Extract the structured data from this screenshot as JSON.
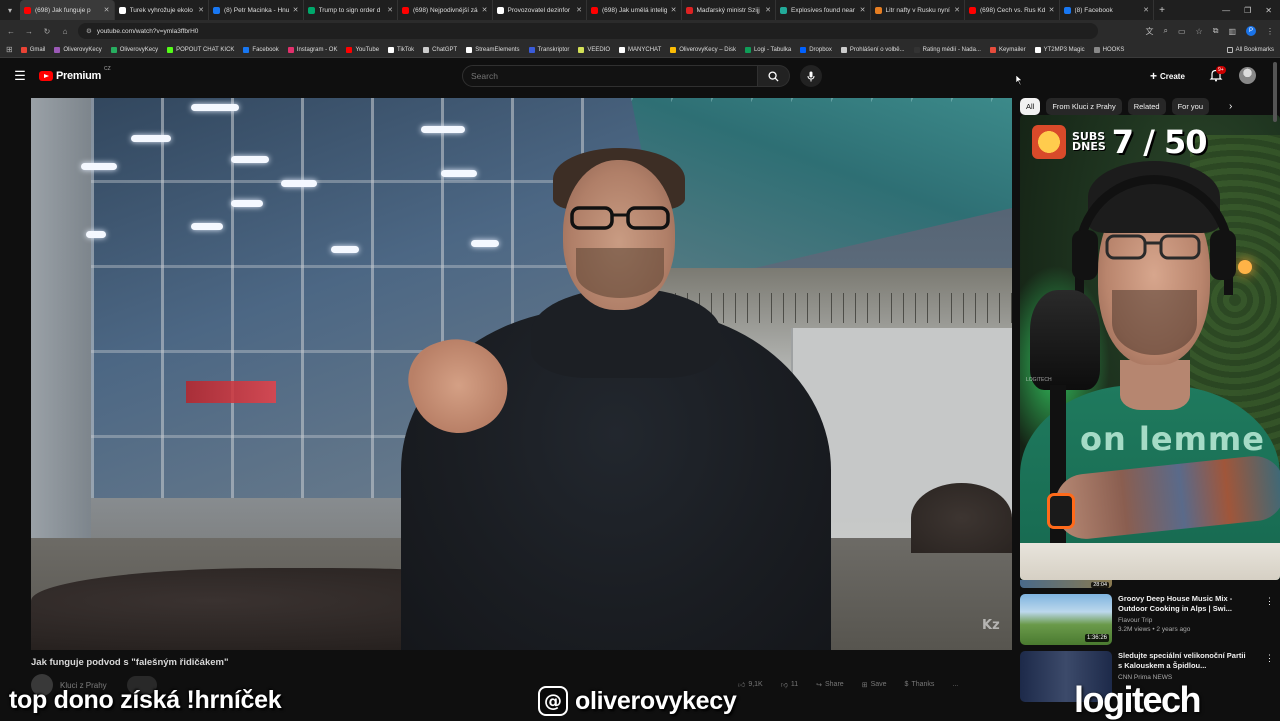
{
  "browser": {
    "tabs": [
      {
        "label": "(698) Jak funguje p",
        "color": "#ff0000",
        "active": true
      },
      {
        "label": "Turek vyhrožuje ekolo",
        "color": "#ffffff"
      },
      {
        "label": "(8) Petr Macinka - Hnu",
        "color": "#1877f2"
      },
      {
        "label": "Trump to sign order d",
        "color": "#00a86b"
      },
      {
        "label": "(698) Nejpodivnější zá",
        "color": "#ff0000"
      },
      {
        "label": "Provozovatel dezinfor",
        "color": "#ffffff"
      },
      {
        "label": "(698) Jak umělá intelig",
        "color": "#ff0000"
      },
      {
        "label": "Maďarský ministr Szijj",
        "color": "#d22"
      },
      {
        "label": "Explosives found near",
        "color": "#2a9"
      },
      {
        "label": "Litr nafty v Rusku nyní",
        "color": "#e67e22"
      },
      {
        "label": "(698) Čech vs. Rus Kd",
        "color": "#ff0000"
      },
      {
        "label": "(8) Facebook",
        "color": "#1877f2"
      }
    ],
    "url": "youtube.com/watch?v=ymla3ffbrH0",
    "bookmarks": [
      {
        "label": "Gmail",
        "color": "#ea4335"
      },
      {
        "label": "OliverovyKecy",
        "color": "#9b59b6"
      },
      {
        "label": "OliverovyKecy",
        "color": "#27ae60"
      },
      {
        "label": "POPOUT CHAT KICK",
        "color": "#53fc18"
      },
      {
        "label": "Facebook",
        "color": "#1877f2"
      },
      {
        "label": "Instagram - OK",
        "color": "#e1306c"
      },
      {
        "label": "YouTube",
        "color": "#ff0000"
      },
      {
        "label": "TikTok",
        "color": "#ffffff"
      },
      {
        "label": "ChatGPT",
        "color": "#cccccc"
      },
      {
        "label": "StreamElements",
        "color": "#ffffff"
      },
      {
        "label": "Transkriptor",
        "color": "#3a5bd9"
      },
      {
        "label": "VEEDIO",
        "color": "#d4e157"
      },
      {
        "label": "MANYCHAT",
        "color": "#ffffff"
      },
      {
        "label": "OliverovyKecy – Disk",
        "color": "#fbbc04"
      },
      {
        "label": "Logi - Tabulka",
        "color": "#0f9d58"
      },
      {
        "label": "Dropbox",
        "color": "#0061ff"
      },
      {
        "label": "Prohlášení o volbě...",
        "color": "#cccccc"
      },
      {
        "label": "Rating médií - Nada...",
        "color": "#333333"
      },
      {
        "label": "Keymailer",
        "color": "#e74c3c"
      },
      {
        "label": "YT2MP3 Magic",
        "color": "#ffffff"
      },
      {
        "label": "HOOKS",
        "color": "#888888"
      }
    ],
    "all_bookmarks": "All Bookmarks"
  },
  "youtube": {
    "logo_text": "Premium",
    "country": "CZ",
    "search_placeholder": "Search",
    "create_label": "Create",
    "notif_count": "9+"
  },
  "video": {
    "title": "Jak funguje podvod s \"falešným řidičákem\"",
    "channel": "Kluci z Prahy",
    "watermark": "Kz",
    "likes": "9,1K",
    "dislikes": "11",
    "share": "Share",
    "save": "Save",
    "thanks": "Thanks",
    "more": "..."
  },
  "sidebar": {
    "chips": [
      "All",
      "From Kluci z Prahy",
      "Related",
      "For you"
    ],
    "partial_duration": "28:04",
    "recs": [
      {
        "title": "Groovy Deep House Music Mix - Outdoor Cooking in Alps | Swi...",
        "channel": "Flavour Trip",
        "stats": "3.2M views • 2 years ago",
        "duration": "1:36:26"
      },
      {
        "title": "Sledujte speciální velikonoční Partii s Kalouskem a Špidlou...",
        "channel": "CNN Prima NEWS",
        "stats": "",
        "duration": ""
      }
    ]
  },
  "stream": {
    "subs_label_1": "SUBS",
    "subs_label_2": "DNES",
    "subs_count": "7 / 50",
    "shirt_text": "on lemme",
    "cam_tag": "LOGITECH",
    "overlay_left": "top dono získá !hrníček",
    "overlay_mid": "oliverovykecy",
    "overlay_right": "logitech"
  }
}
